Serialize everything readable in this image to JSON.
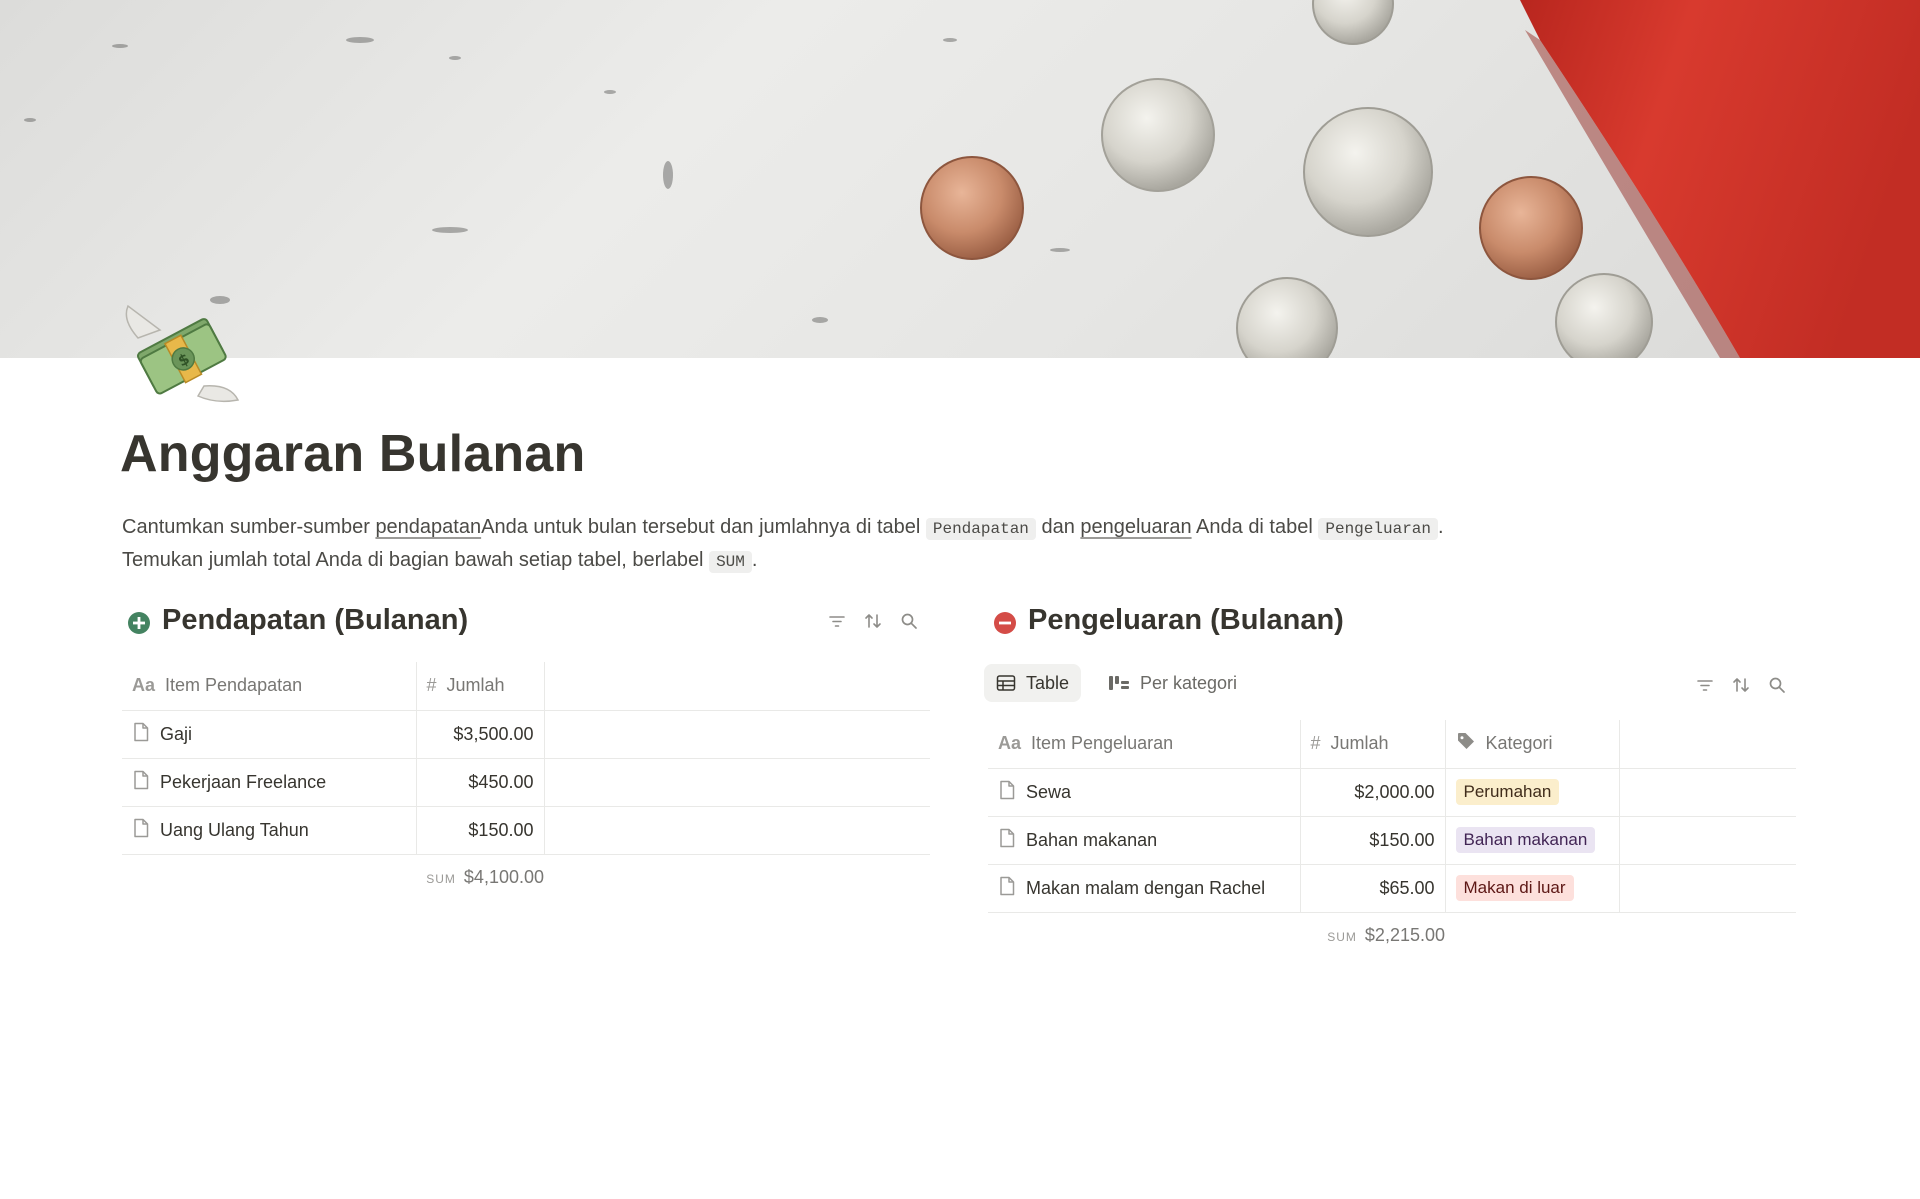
{
  "cover": {
    "colors": {
      "marble": "#e6e6e4",
      "red": "#d4372b",
      "penny": "#c98b6b",
      "silver": "#cfcfcb"
    }
  },
  "page_icon": "money-with-wings-icon",
  "title": "Anggaran Bulanan",
  "description": {
    "p1_a": "Cantumkan  sumber-sumber ",
    "p1_link1": "pendapatan",
    "p1_b": "Anda  untuk bulan tersebut dan jumlahnya di  tabel ",
    "p1_code1": "Pendapatan",
    "p1_c": " dan ",
    "p1_link2": "pengeluaran",
    "p1_d": " Anda  di  tabel ",
    "p1_code2": "Pengeluaran",
    "p1_e": ".",
    "p2_a": " Temukan jumlah total Anda di bagian bawah setiap tabel, berlabel ",
    "p2_code": "SUM",
    "p2_b": "."
  },
  "income": {
    "icon": "plus-circle-icon",
    "icon_color": "#448361",
    "title": "Pendapatan (Bulanan)",
    "columns": {
      "name": "Item Pendapatan",
      "amount": "Jumlah"
    },
    "rows": [
      {
        "name": "Gaji",
        "amount": "$3,500.00"
      },
      {
        "name": "Pekerjaan Freelance",
        "amount": "$450.00"
      },
      {
        "name": "Uang Ulang Tahun",
        "amount": "$150.00"
      }
    ],
    "sum_label": "SUM",
    "sum_value": "$4,100.00"
  },
  "expenses": {
    "icon": "minus-circle-icon",
    "icon_color": "#d44c47",
    "title": "Pengeluaran (Bulanan)",
    "views": {
      "table": "Table",
      "by_category": "Per kategori"
    },
    "columns": {
      "name": "Item Pengeluaran",
      "amount": "Jumlah",
      "category": "Kategori"
    },
    "rows": [
      {
        "name": "Sewa",
        "amount": "$2,000.00",
        "category": "Perumahan",
        "tag_bg": "#fbeecc",
        "tag_fg": "#402c1b"
      },
      {
        "name": "Bahan makanan",
        "amount": "$150.00",
        "category": "Bahan makanan",
        "tag_bg": "#eae4f2",
        "tag_fg": "#412454"
      },
      {
        "name": "Makan malam dengan Rachel",
        "amount": "$65.00",
        "category": "Makan di luar",
        "tag_bg": "#fde0dc",
        "tag_fg": "#5d1715"
      }
    ],
    "sum_label": "SUM",
    "sum_value": "$2,215.00"
  }
}
